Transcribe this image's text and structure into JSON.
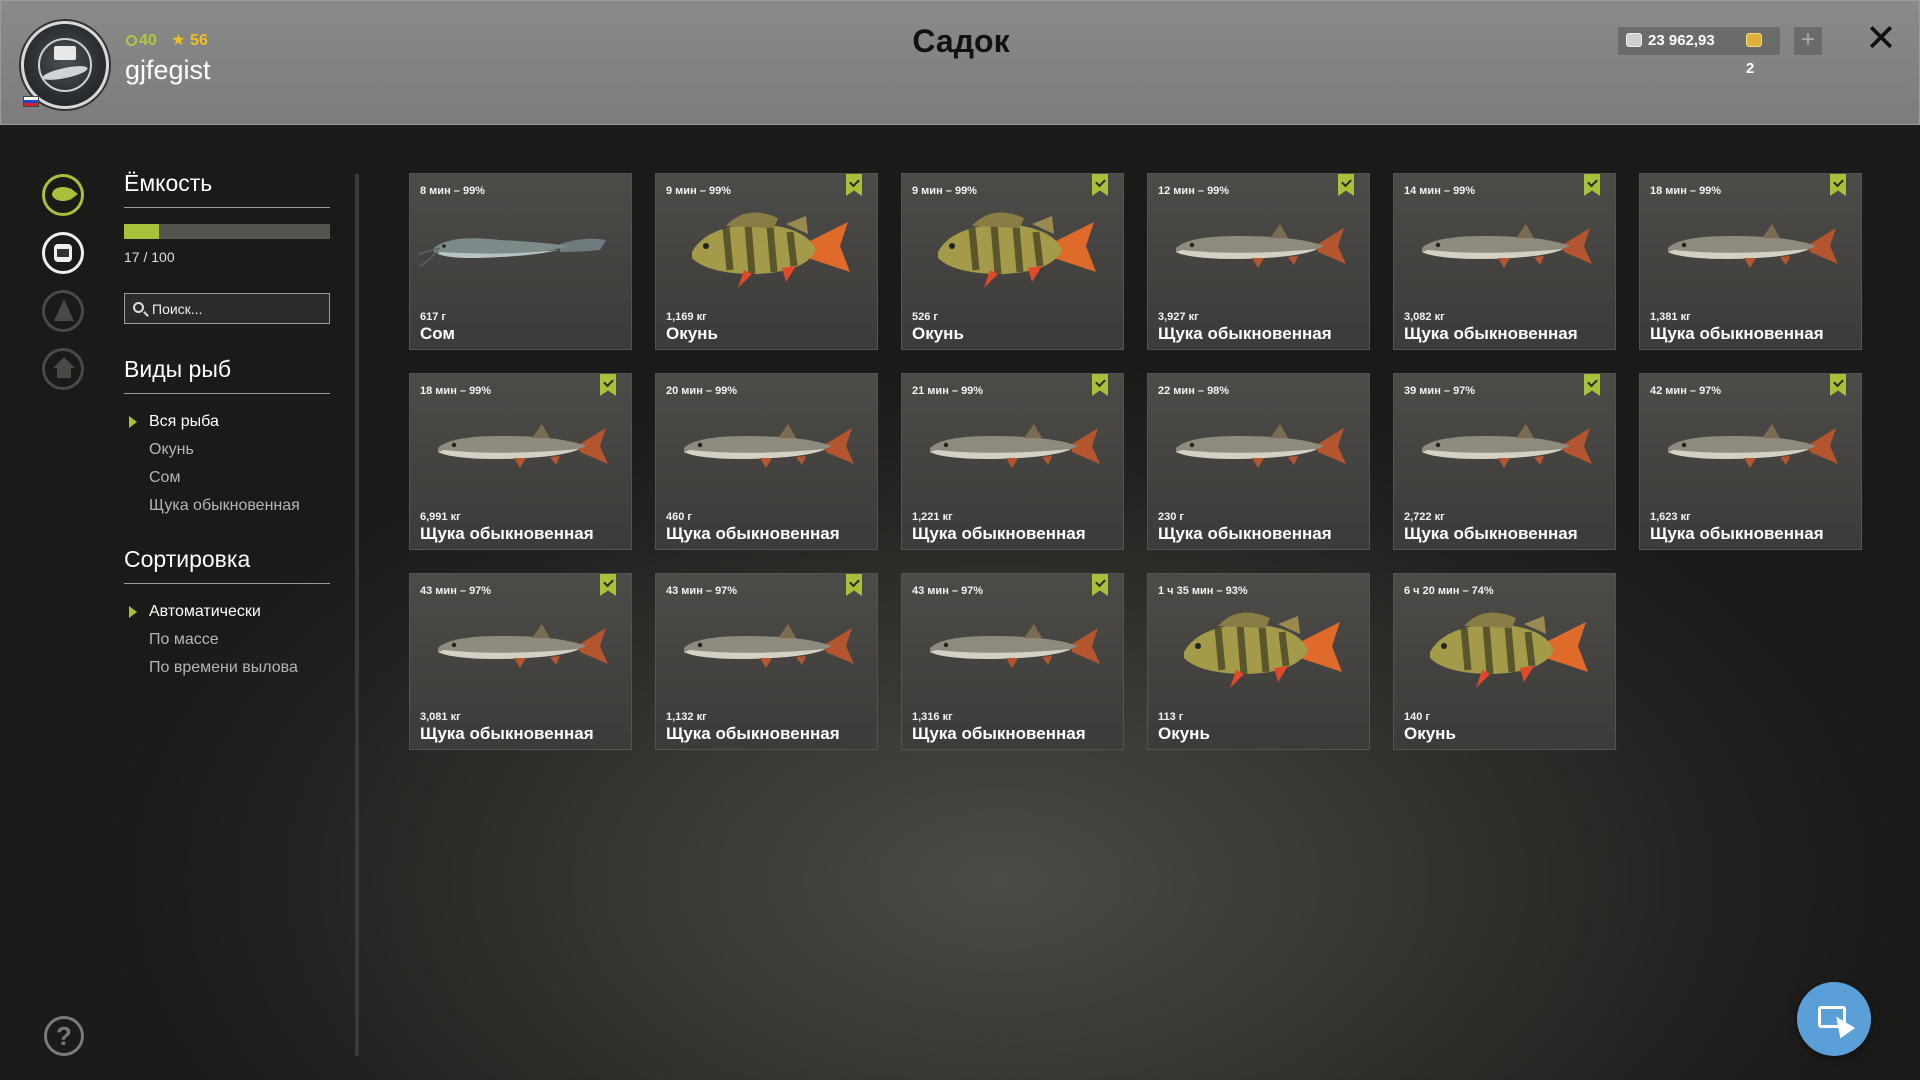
{
  "header": {
    "title": "Садок",
    "username": "gjfegist",
    "level": "40",
    "rank": "56",
    "silver": "23 962,93",
    "gold": "2",
    "plus_label": "+",
    "close_label": "✕"
  },
  "panel": {
    "capacity_title": "Ёмкость",
    "capacity_text": "17 / 100",
    "capacity_fraction": 0.17,
    "search_placeholder": "Поиск...",
    "species_title": "Виды рыб",
    "species": [
      {
        "label": "Вся рыба",
        "active": true
      },
      {
        "label": "Окунь",
        "active": false
      },
      {
        "label": "Сом",
        "active": false
      },
      {
        "label": "Щука обыкновенная",
        "active": false
      }
    ],
    "sort_title": "Сортировка",
    "sort": [
      {
        "label": "Автоматически",
        "active": true
      },
      {
        "label": "По массе",
        "active": false
      },
      {
        "label": "По времени вылова",
        "active": false
      }
    ]
  },
  "help_label": "?",
  "fish": [
    {
      "time": "8 мин – 99%",
      "weight": "617 г",
      "name": "Сом",
      "kind": "catfish",
      "bookmarked": false
    },
    {
      "time": "9 мин – 99%",
      "weight": "1,169 кг",
      "name": "Окунь",
      "kind": "perch",
      "bookmarked": true
    },
    {
      "time": "9 мин – 99%",
      "weight": "526 г",
      "name": "Окунь",
      "kind": "perch",
      "bookmarked": true
    },
    {
      "time": "12 мин – 99%",
      "weight": "3,927 кг",
      "name": "Щука обыкновенная",
      "kind": "pike",
      "bookmarked": true
    },
    {
      "time": "14 мин – 99%",
      "weight": "3,082 кг",
      "name": "Щука обыкновенная",
      "kind": "pike",
      "bookmarked": true
    },
    {
      "time": "18 мин – 99%",
      "weight": "1,381 кг",
      "name": "Щука обыкновенная",
      "kind": "pike",
      "bookmarked": true
    },
    {
      "time": "18 мин – 99%",
      "weight": "6,991 кг",
      "name": "Щука обыкновенная",
      "kind": "pike",
      "bookmarked": true
    },
    {
      "time": "20 мин – 99%",
      "weight": "460 г",
      "name": "Щука обыкновенная",
      "kind": "pike",
      "bookmarked": false
    },
    {
      "time": "21 мин – 99%",
      "weight": "1,221 кг",
      "name": "Щука обыкновенная",
      "kind": "pike",
      "bookmarked": true
    },
    {
      "time": "22 мин – 98%",
      "weight": "230 г",
      "name": "Щука обыкновенная",
      "kind": "pike",
      "bookmarked": false
    },
    {
      "time": "39 мин – 97%",
      "weight": "2,722 кг",
      "name": "Щука обыкновенная",
      "kind": "pike",
      "bookmarked": true
    },
    {
      "time": "42 мин – 97%",
      "weight": "1,623 кг",
      "name": "Щука обыкновенная",
      "kind": "pike",
      "bookmarked": true
    },
    {
      "time": "43 мин – 97%",
      "weight": "3,081 кг",
      "name": "Щука обыкновенная",
      "kind": "pike",
      "bookmarked": true
    },
    {
      "time": "43 мин – 97%",
      "weight": "1,132 кг",
      "name": "Щука обыкновенная",
      "kind": "pike",
      "bookmarked": true
    },
    {
      "time": "43 мин – 97%",
      "weight": "1,316 кг",
      "name": "Щука обыкновенная",
      "kind": "pike",
      "bookmarked": true
    },
    {
      "time": "1 ч 35 мин – 93%",
      "weight": "113 г",
      "name": "Окунь",
      "kind": "perch",
      "bookmarked": false
    },
    {
      "time": "6 ч 20 мин – 74%",
      "weight": "140 г",
      "name": "Окунь",
      "kind": "perch",
      "bookmarked": false
    }
  ],
  "colors": {
    "accent": "#a7c13a",
    "gold": "#f0c020",
    "float_button": "#5a9fd8"
  },
  "icons": {
    "fish_tab": "fish-icon",
    "keepnet_tab": "keepnet-icon",
    "camp_tab": "camp-icon",
    "home_tab": "home-icon",
    "help": "help-icon",
    "float": "cursor-screen-icon"
  }
}
